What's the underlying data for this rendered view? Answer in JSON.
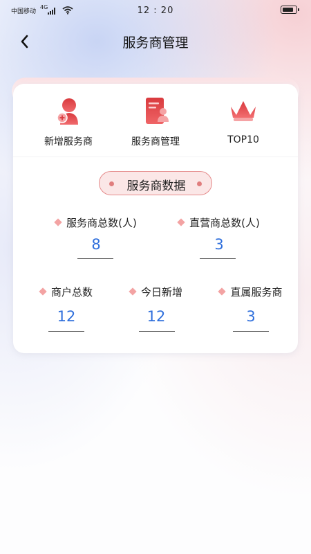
{
  "status_bar": {
    "carrier": "中国移动",
    "network": "4G",
    "time": "12 : 20"
  },
  "header": {
    "title": "服务商管理",
    "back_icon": "chevron-left-icon"
  },
  "quick_actions": [
    {
      "label": "新增服务商",
      "icon": "add-user-icon"
    },
    {
      "label": "服务商管理",
      "icon": "document-user-icon"
    },
    {
      "label": "TOP10",
      "icon": "crown-icon"
    }
  ],
  "section": {
    "title": "服务商数据"
  },
  "stats_row1": [
    {
      "label": "服务商总数(人)",
      "value": "8"
    },
    {
      "label": "直营商总数(人)",
      "value": "3"
    }
  ],
  "stats_row2": [
    {
      "label": "商户总数",
      "value": "12"
    },
    {
      "label": "今日新增",
      "value": "12"
    },
    {
      "label": "直属服务商",
      "value": "3"
    }
  ],
  "colors": {
    "accent": "#e5484d",
    "value_blue": "#2f6fdc",
    "diamond": "#f3a3a3"
  }
}
